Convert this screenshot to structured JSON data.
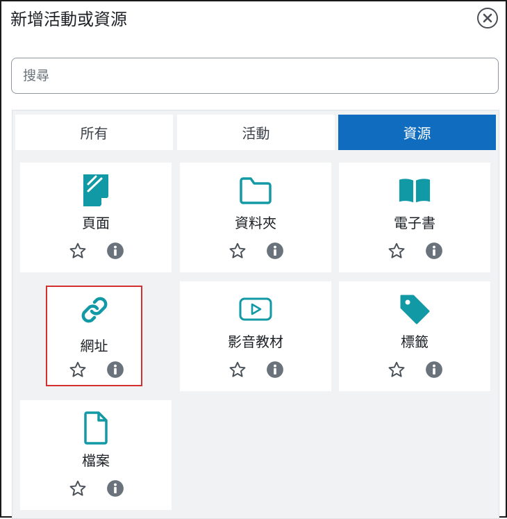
{
  "dialog": {
    "title": "新增活動或資源",
    "close_icon": "close-circle-icon"
  },
  "search": {
    "placeholder": "搜尋"
  },
  "tabs": [
    {
      "label": "所有",
      "active": false
    },
    {
      "label": "活動",
      "active": false
    },
    {
      "label": "資源",
      "active": true
    }
  ],
  "modules": [
    {
      "label": "頁面",
      "icon": "page-icon"
    },
    {
      "label": "資料夾",
      "icon": "folder-icon"
    },
    {
      "label": "電子書",
      "icon": "book-icon"
    },
    {
      "label": "網址",
      "icon": "link-icon",
      "highlighted": true
    },
    {
      "label": "影音教材",
      "icon": "video-icon"
    },
    {
      "label": "標籤",
      "icon": "tag-icon"
    },
    {
      "label": "檔案",
      "icon": "file-icon"
    }
  ],
  "colors": {
    "accent": "#0f6cbf",
    "module_icon": "#1199a5",
    "highlight": "#d32f2f"
  }
}
